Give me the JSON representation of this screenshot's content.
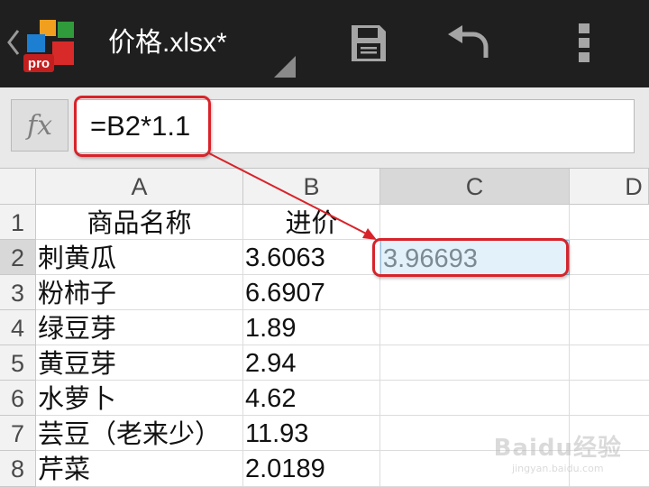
{
  "app": {
    "logo_text": "pro",
    "file_title": "价格.xlsx*"
  },
  "toolbar": {
    "save_icon": "floppy-disk-icon",
    "undo_icon": "undo-arrow-icon",
    "more_icon": "vertical-ellipsis-icon"
  },
  "formula_bar": {
    "fx_label": "fx",
    "value": "=B2*1.1"
  },
  "sheet": {
    "column_headers": [
      "A",
      "B",
      "C",
      "D"
    ],
    "selected_column": "C",
    "selected_row": "2",
    "active_cell": "C2",
    "rows": [
      {
        "num": "1",
        "a": "商品名称",
        "b": "进价",
        "c": ""
      },
      {
        "num": "2",
        "a": "刺黄瓜",
        "b": "3.6063",
        "c": "3.96693"
      },
      {
        "num": "3",
        "a": "粉柿子",
        "b": "6.6907",
        "c": ""
      },
      {
        "num": "4",
        "a": "绿豆芽",
        "b": "1.89",
        "c": ""
      },
      {
        "num": "5",
        "a": "黄豆芽",
        "b": "2.94",
        "c": ""
      },
      {
        "num": "6",
        "a": "水萝卜",
        "b": "4.62",
        "c": ""
      },
      {
        "num": "7",
        "a": "芸豆（老来少）",
        "b": "11.93",
        "c": ""
      },
      {
        "num": "8",
        "a": "芹菜",
        "b": "2.0189",
        "c": ""
      }
    ]
  },
  "annotation": {
    "color": "#d8232a"
  },
  "watermark": {
    "brand": "Baidu经验",
    "url": "jingyan.baidu.com"
  },
  "colors": {
    "topbar": "#1f1f1f",
    "active_cell_bg": "#e2f1fa",
    "header_bg": "#f2f2f2",
    "header_selected_bg": "#d8d8d8"
  }
}
